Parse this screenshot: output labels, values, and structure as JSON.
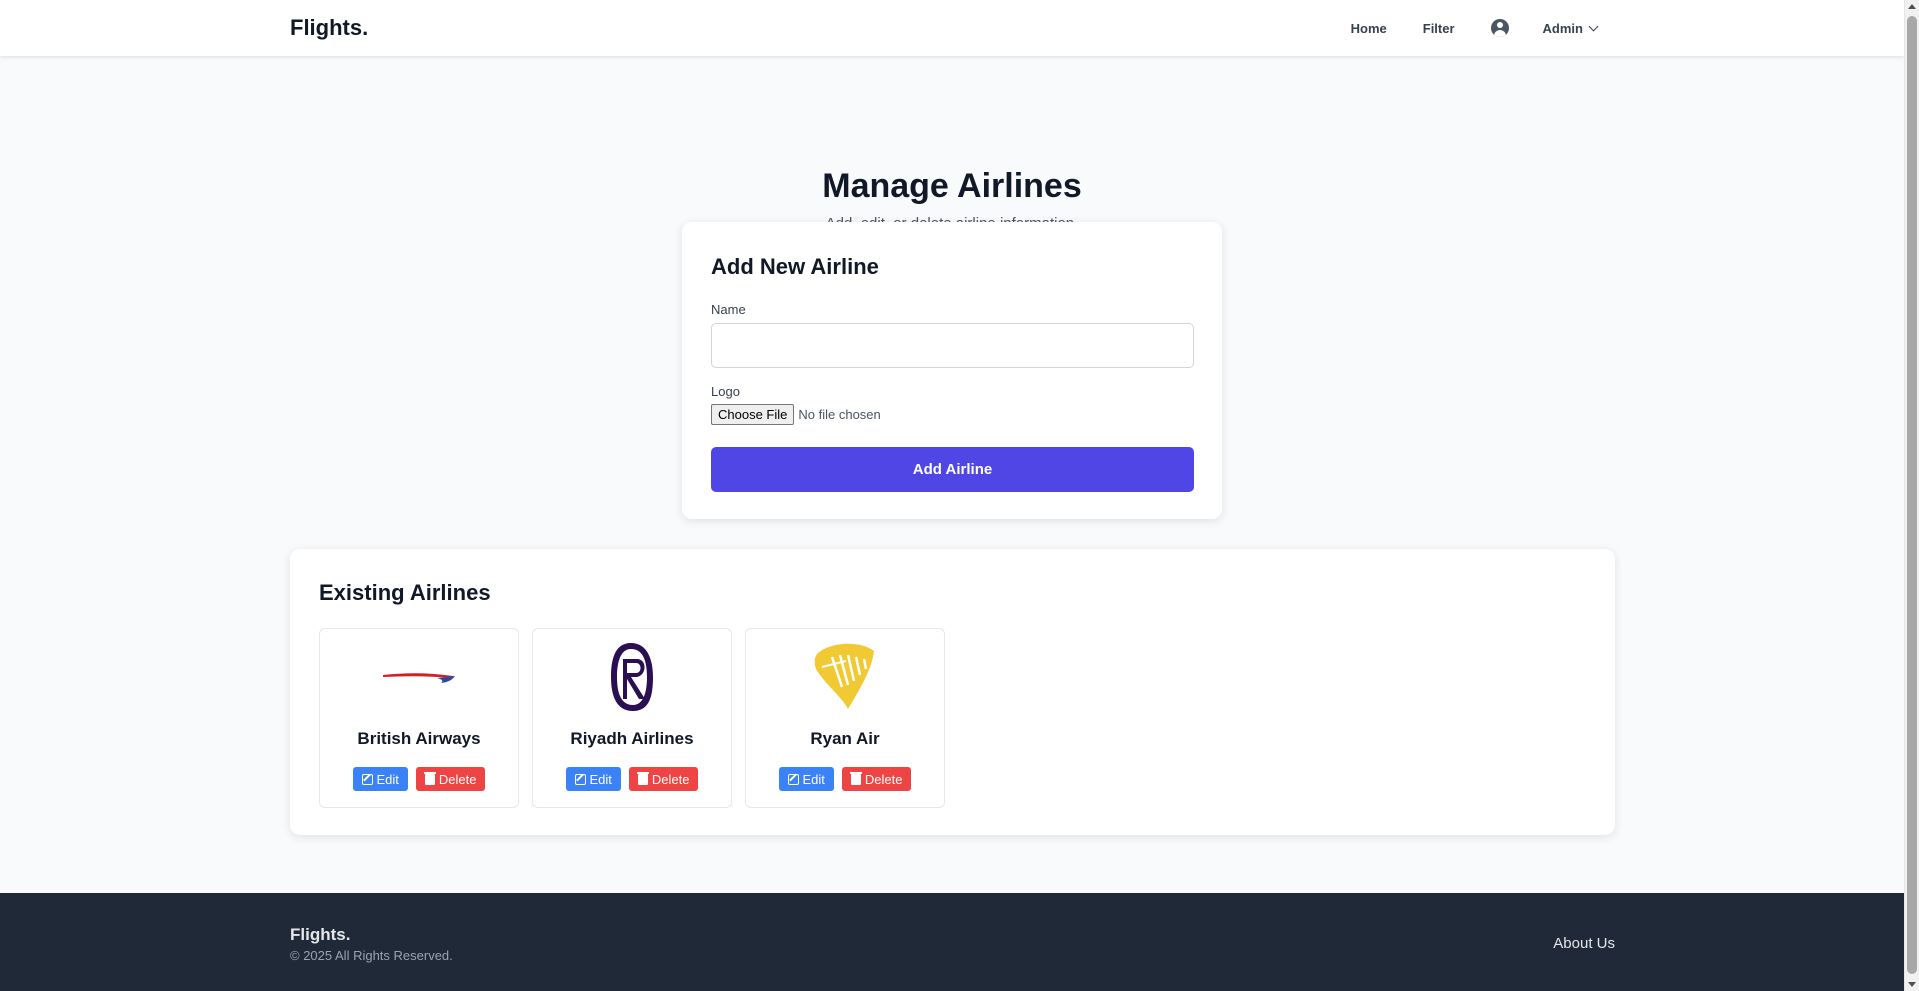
{
  "header": {
    "brand": "Flights.",
    "nav": {
      "home": "Home",
      "filter": "Filter",
      "user_icon": "user-circle-icon",
      "admin": "Admin"
    }
  },
  "hero": {
    "title": "Manage Airlines",
    "subtitle": "Add, edit, or delete airline information."
  },
  "add_form": {
    "title": "Add New Airline",
    "name_label": "Name",
    "name_value": "",
    "logo_label": "Logo",
    "choose_file_label": "Choose File",
    "file_status": "No file chosen",
    "submit_label": "Add Airline",
    "submit_color": "#4f46e5"
  },
  "existing": {
    "title": "Existing Airlines",
    "edit_label": "Edit",
    "delete_label": "Delete",
    "airlines": [
      {
        "name": "British Airways",
        "logo": "british-airways-logo"
      },
      {
        "name": "Riyadh Airlines",
        "logo": "riyadh-airlines-logo"
      },
      {
        "name": "Ryan Air",
        "logo": "ryanair-logo"
      }
    ]
  },
  "footer": {
    "brand": "Flights.",
    "copyright": "© 2025 All Rights Reserved.",
    "about": "About Us"
  },
  "colors": {
    "edit": "#3b82f6",
    "delete": "#ef4444",
    "footer_bg": "#1f2937"
  }
}
